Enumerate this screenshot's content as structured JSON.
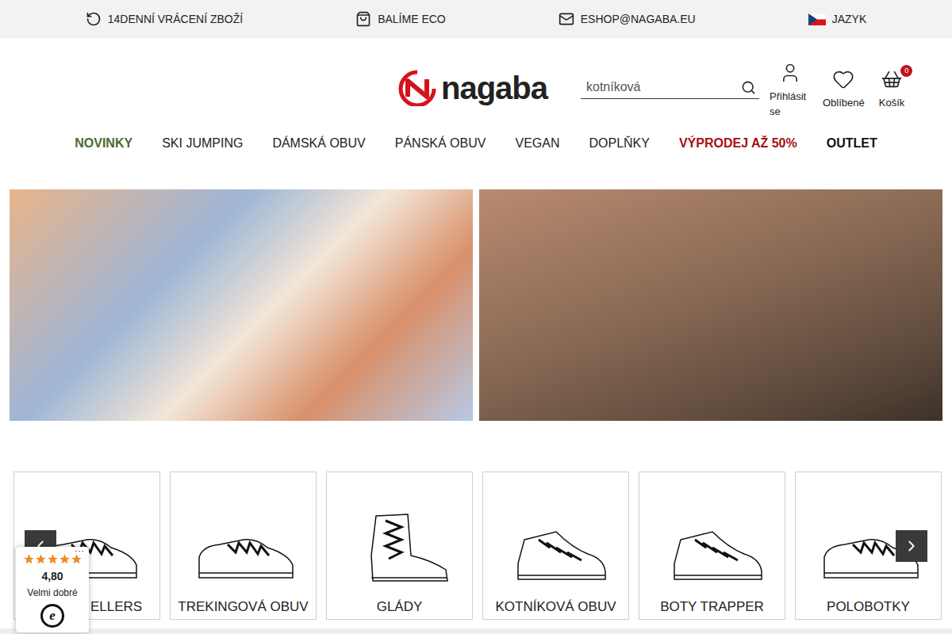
{
  "top_bar": [
    {
      "text": "14DENNÍ VRÁCENÍ ZBOŽÍ",
      "kind": "return"
    },
    {
      "text": "BALÍME ECO",
      "kind": "eco"
    },
    {
      "text": "ESHOP@NAGABA.EU",
      "kind": "mail"
    },
    {
      "text": "JAZYK",
      "kind": "flag"
    }
  ],
  "logo": {
    "text": "nagaba"
  },
  "search": {
    "placeholder": "kotníková"
  },
  "account": {
    "label": "Přihlásit se"
  },
  "favorites": {
    "label": "Oblíbené"
  },
  "cart": {
    "label": "Košík",
    "count": "0"
  },
  "nav": [
    {
      "label": "NOVINKY",
      "color": "#4b6b2e",
      "bold": true
    },
    {
      "label": "SKI JUMPING",
      "color": "#222222",
      "bold": false
    },
    {
      "label": "DÁMSKÁ OBUV",
      "color": "#222222",
      "bold": false
    },
    {
      "label": "PÁNSKÁ OBUV",
      "color": "#222222",
      "bold": false
    },
    {
      "label": "VEGAN",
      "color": "#222222",
      "bold": false
    },
    {
      "label": "DOPLŇKY",
      "color": "#222222",
      "bold": false
    },
    {
      "label": "VÝPRODEJ AŽ 50%",
      "color": "#a50f0f",
      "bold": true
    },
    {
      "label": "OUTLET",
      "color": "#111111",
      "bold": true
    }
  ],
  "categories": [
    {
      "label": "ELLERS",
      "kind": "low"
    },
    {
      "label": "TREKINGOVÁ OBUV",
      "kind": "low"
    },
    {
      "label": "GLÁDY",
      "kind": "boot"
    },
    {
      "label": "KOTNÍKOVÁ OBUV",
      "kind": "mid"
    },
    {
      "label": "BOTY TRAPPER",
      "kind": "mid"
    },
    {
      "label": "POLOBOTKY",
      "kind": "low"
    }
  ],
  "trust_badge": {
    "stars": 5,
    "rating": "4,80",
    "label": "Velmi dobré",
    "logo": "e",
    "menu": "···"
  }
}
